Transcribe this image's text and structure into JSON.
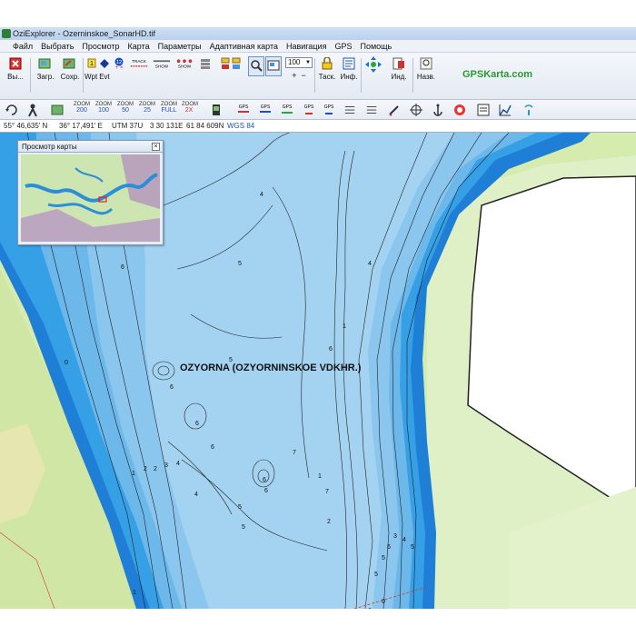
{
  "window": {
    "title": "OziExplorer - Ozerninskoe_SonarHD.tif"
  },
  "menu": [
    "Файл",
    "Выбрать",
    "Просмотр",
    "Карта",
    "Параметры",
    "Адаптивная карта",
    "Навигация",
    "GPS",
    "Помощь"
  ],
  "toolbar": {
    "exit_label": "Вы...",
    "load_label": "Загр.",
    "save_label": "Сохр.",
    "wpt_label": "Wpt",
    "evt_label": "Evt",
    "track_label": "TRACK",
    "show_label": "SHOW",
    "zoom_value": "100",
    "task_label": "Таск.",
    "info_label": "Инф.",
    "ind_label": "Инд.",
    "name_label": "Назв.",
    "brand": "GPSKarta.com"
  },
  "toolbar2": {
    "zoom_buttons": [
      "200",
      "100",
      "50",
      "25",
      "FULL",
      "2X"
    ],
    "zoom_prefix": "ZOOM"
  },
  "status": {
    "lat": "55° 46,635' N",
    "lon": "36° 17,491' E",
    "utm": "UTM  37U",
    "easting": "3 30 131E",
    "northing": "61 84 609N",
    "datum": "WGS 84"
  },
  "overview": {
    "title": "Просмотр карты"
  },
  "map": {
    "lake_name": "OZYORNA (OZYORNINSKOE VDKHR.)",
    "depth_labels": [
      "4",
      "6",
      "5",
      "4",
      "1",
      "6",
      "0",
      "6",
      "6",
      "6",
      "1",
      "2",
      "2",
      "3",
      "4",
      "4",
      "5",
      "5",
      "6",
      "6",
      "7",
      "7",
      "1",
      "2",
      "3",
      "4",
      "6",
      "5",
      "1",
      "6",
      "0",
      "5",
      "5",
      "5"
    ],
    "colors": {
      "deep": "#9ccdee",
      "mid": "#7fc0ec",
      "shallow": "#36a0e6",
      "edge": "#1f7fd6",
      "land": "#cfe6a5",
      "land_light": "#dff0c2",
      "white_area": "#ffffff"
    }
  }
}
